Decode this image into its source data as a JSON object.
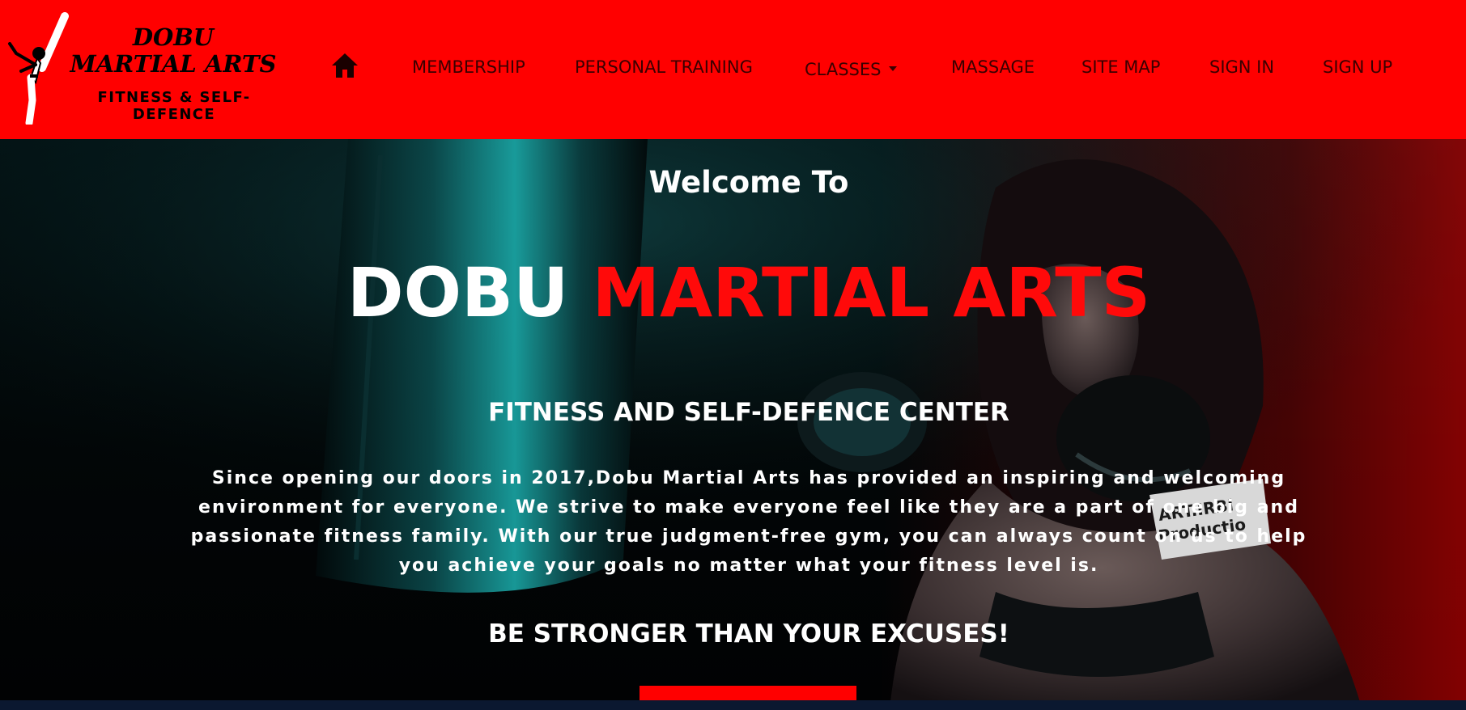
{
  "brand": {
    "logo_title_line1": "DOBU",
    "logo_title_line2": "MARTIAL ARTS",
    "logo_tagline": "FITNESS & SELF-DEFENCE"
  },
  "nav": {
    "home_icon": "home-icon",
    "items": [
      {
        "label": "MEMBERSHIP"
      },
      {
        "label": "PERSONAL TRAINING"
      },
      {
        "label": "CLASSES",
        "dropdown": true
      },
      {
        "label": "MASSAGE"
      },
      {
        "label": "SITE MAP"
      },
      {
        "label": "SIGN IN"
      },
      {
        "label": "SIGN UP"
      }
    ]
  },
  "hero": {
    "welcome": "Welcome To",
    "title_white": "DOBU",
    "title_red": "MARTIAL ARTS",
    "subtitle": "FITNESS AND SELF-DEFENCE CENTER",
    "intro": "Since opening our doors in 2017,Dobu Martial Arts has provided an inspiring and welcoming environment for everyone. We strive to make everyone feel like they are a part of one big and passionate fitness family. With our true judgment-free gym, you can always count on us to help you achieve your goals no matter what your fitness level is.",
    "slogan": "BE STRONGER THAN YOUR EXCUSES!",
    "watermark": "ART.IRBI Production"
  },
  "colors": {
    "navbar": "#ff0000",
    "accent_red": "#ff0a0a",
    "nav_text": "#3a0000",
    "hero_text": "#ffffff"
  }
}
